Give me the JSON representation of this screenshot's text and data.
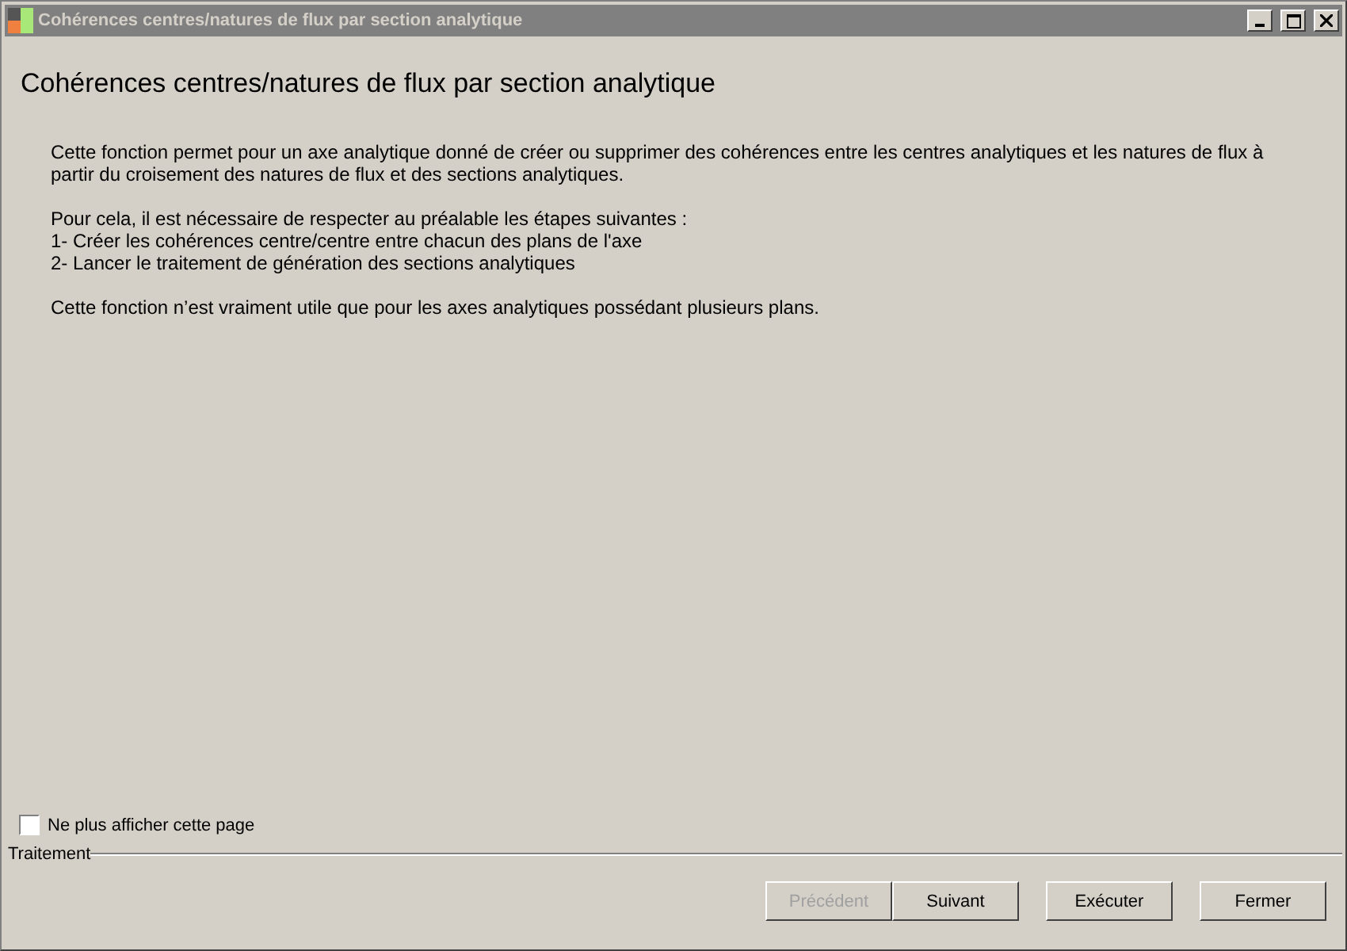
{
  "window": {
    "title": "Cohérences centres/natures de flux par section analytique",
    "controls": [
      {
        "kind": "minimize"
      },
      {
        "kind": "maximize"
      },
      {
        "kind": "close"
      }
    ]
  },
  "heading": "Cohérences centres/natures de flux par section analytique",
  "paragraphs": [
    [
      "Cette fonction permet pour un axe analytique donné de créer ou supprimer des cohérences entre les centres analytiques et les natures de flux à partir du croisement des natures de flux et des sections analytiques."
    ],
    [
      "Pour cela, il est nécessaire de respecter au préalable les étapes suivantes :",
      "1- Créer les cohérences centre/centre entre chacun des plans de l'axe",
      "2- Lancer le traitement de génération des sections analytiques"
    ],
    [
      "Cette fonction n’est vraiment utile que pour les axes analytiques possédant plusieurs plans."
    ]
  ],
  "checkbox": {
    "label": "Ne plus afficher cette page",
    "checked": false
  },
  "group_label": "Traitement",
  "buttons": [
    {
      "label": "Précédent",
      "disabled": true
    },
    {
      "label": "Suivant",
      "disabled": false
    },
    {
      "label": "Exécuter",
      "disabled": false
    },
    {
      "label": "Fermer",
      "disabled": false
    }
  ]
}
